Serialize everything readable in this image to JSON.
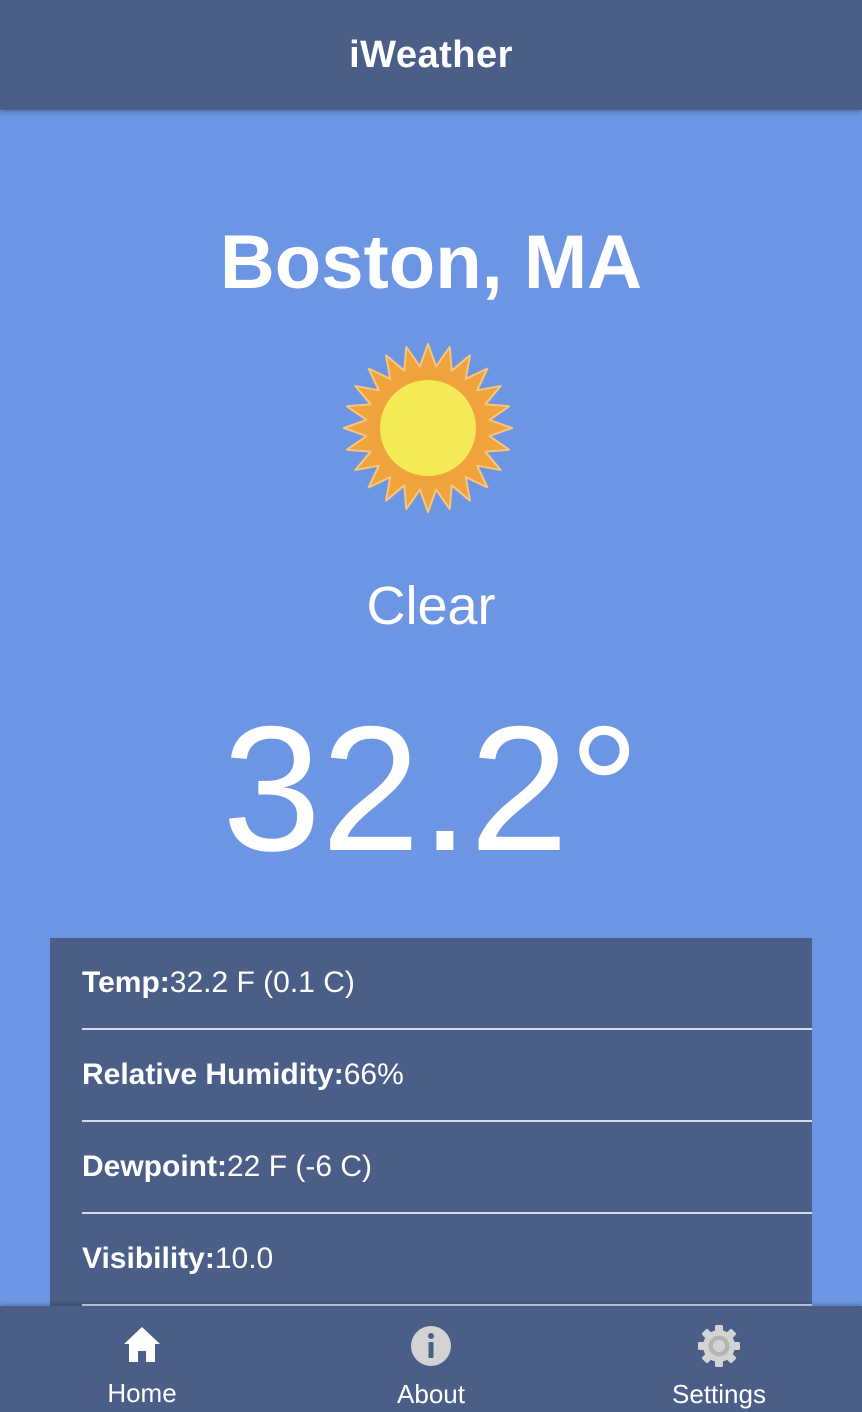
{
  "header": {
    "title": "iWeather"
  },
  "current": {
    "location": "Boston, MA",
    "condition": "Clear",
    "condition_icon": "sun-icon",
    "temperature": "32.2°"
  },
  "details": [
    {
      "label": "Temp:",
      "value": "32.2 F (0.1 C)"
    },
    {
      "label": "Relative Humidity:",
      "value": "66%"
    },
    {
      "label": "Dewpoint:",
      "value": "22 F (-6 C)"
    },
    {
      "label": "Visibility:",
      "value": "10.0"
    }
  ],
  "tabs": [
    {
      "label": "Home",
      "icon": "home-icon",
      "active": true
    },
    {
      "label": "About",
      "icon": "info-icon",
      "active": false
    },
    {
      "label": "Settings",
      "icon": "gear-icon",
      "active": false
    }
  ],
  "colors": {
    "background": "#6c96e4",
    "bar": "#4a5e88",
    "text": "#ffffff",
    "inactive_icon": "#d3d3d3",
    "sun_core": "#f4ea55",
    "sun_rays": "#f0a23c"
  }
}
